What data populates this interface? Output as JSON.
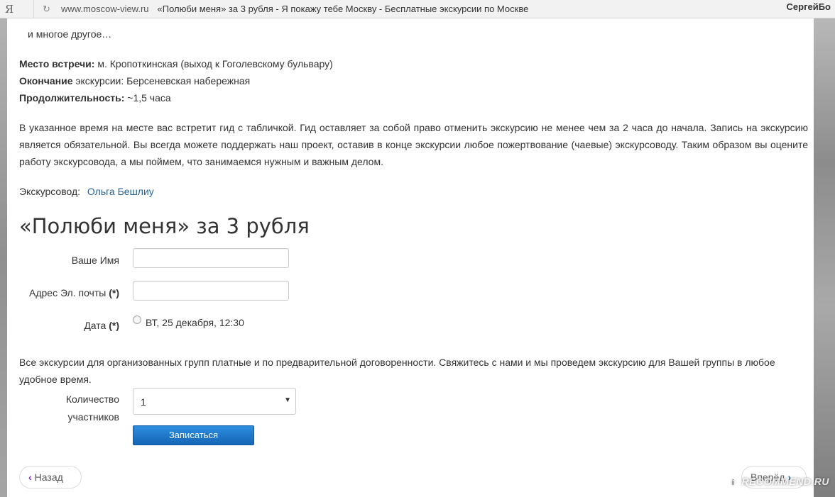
{
  "browser": {
    "logo": "Я",
    "refresh_icon": "refresh-icon",
    "url_host": "www.moscow-view.ru",
    "tab_title": "«Полюби меня» за 3 рубля - Я покажу тебе Москву - Бесплатные экскурсии по Москве",
    "user_name": "СергейБо"
  },
  "content": {
    "intro_tail": "и многое другое…",
    "meeting": {
      "label": "Место встречи:",
      "value": " м. Кропоткинская (выход к Гоголевскому бульвару)"
    },
    "end": {
      "label": "Окончание",
      "value": " экскурсии: Берсеневская набережная"
    },
    "duration": {
      "label": "Продолжительность:",
      "value": " ~1,5 часа"
    },
    "info_paragraph": " В указанное время на месте вас встретит гид с табличкой. Гид оставляет за собой право отменить экскурсию не менее чем за 2 часа до начала. Запись на экскурсию является обязательной. Вы всегда можете поддержать наш проект, оставив в конце экскурсии любое пожертвование (чаевые) экскурсоводу. Таким образом вы оцените работу экскурсовода, а мы поймем, что занимаемся нужным и важным делом.",
    "guide_label": "Экскурсовод:",
    "guide_name": "Ольга Бешлиу"
  },
  "form": {
    "title": "«Полюби меня» за 3 рубля",
    "name_label": "Ваше Имя",
    "name_value": "",
    "email_label": "Адрес Эл. почты",
    "email_value": "",
    "required_mark": "(*)",
    "date_label": "Дата",
    "date_option": "ВТ, 25 декабря, 12:30",
    "groups_note": "Все экскурсии для организованных групп платные и по предварительной договоренности. Свяжитесь с нами и мы проведем экскурсию для Вашей группы в любое удобное время.",
    "count_label_1": "Количество",
    "count_label_2": "участников",
    "count_value": "1",
    "submit_label": "Записаться"
  },
  "nav": {
    "back_label": "Назад",
    "next_label": "Вперёд"
  },
  "watermark": "RECOMMEND.RU"
}
